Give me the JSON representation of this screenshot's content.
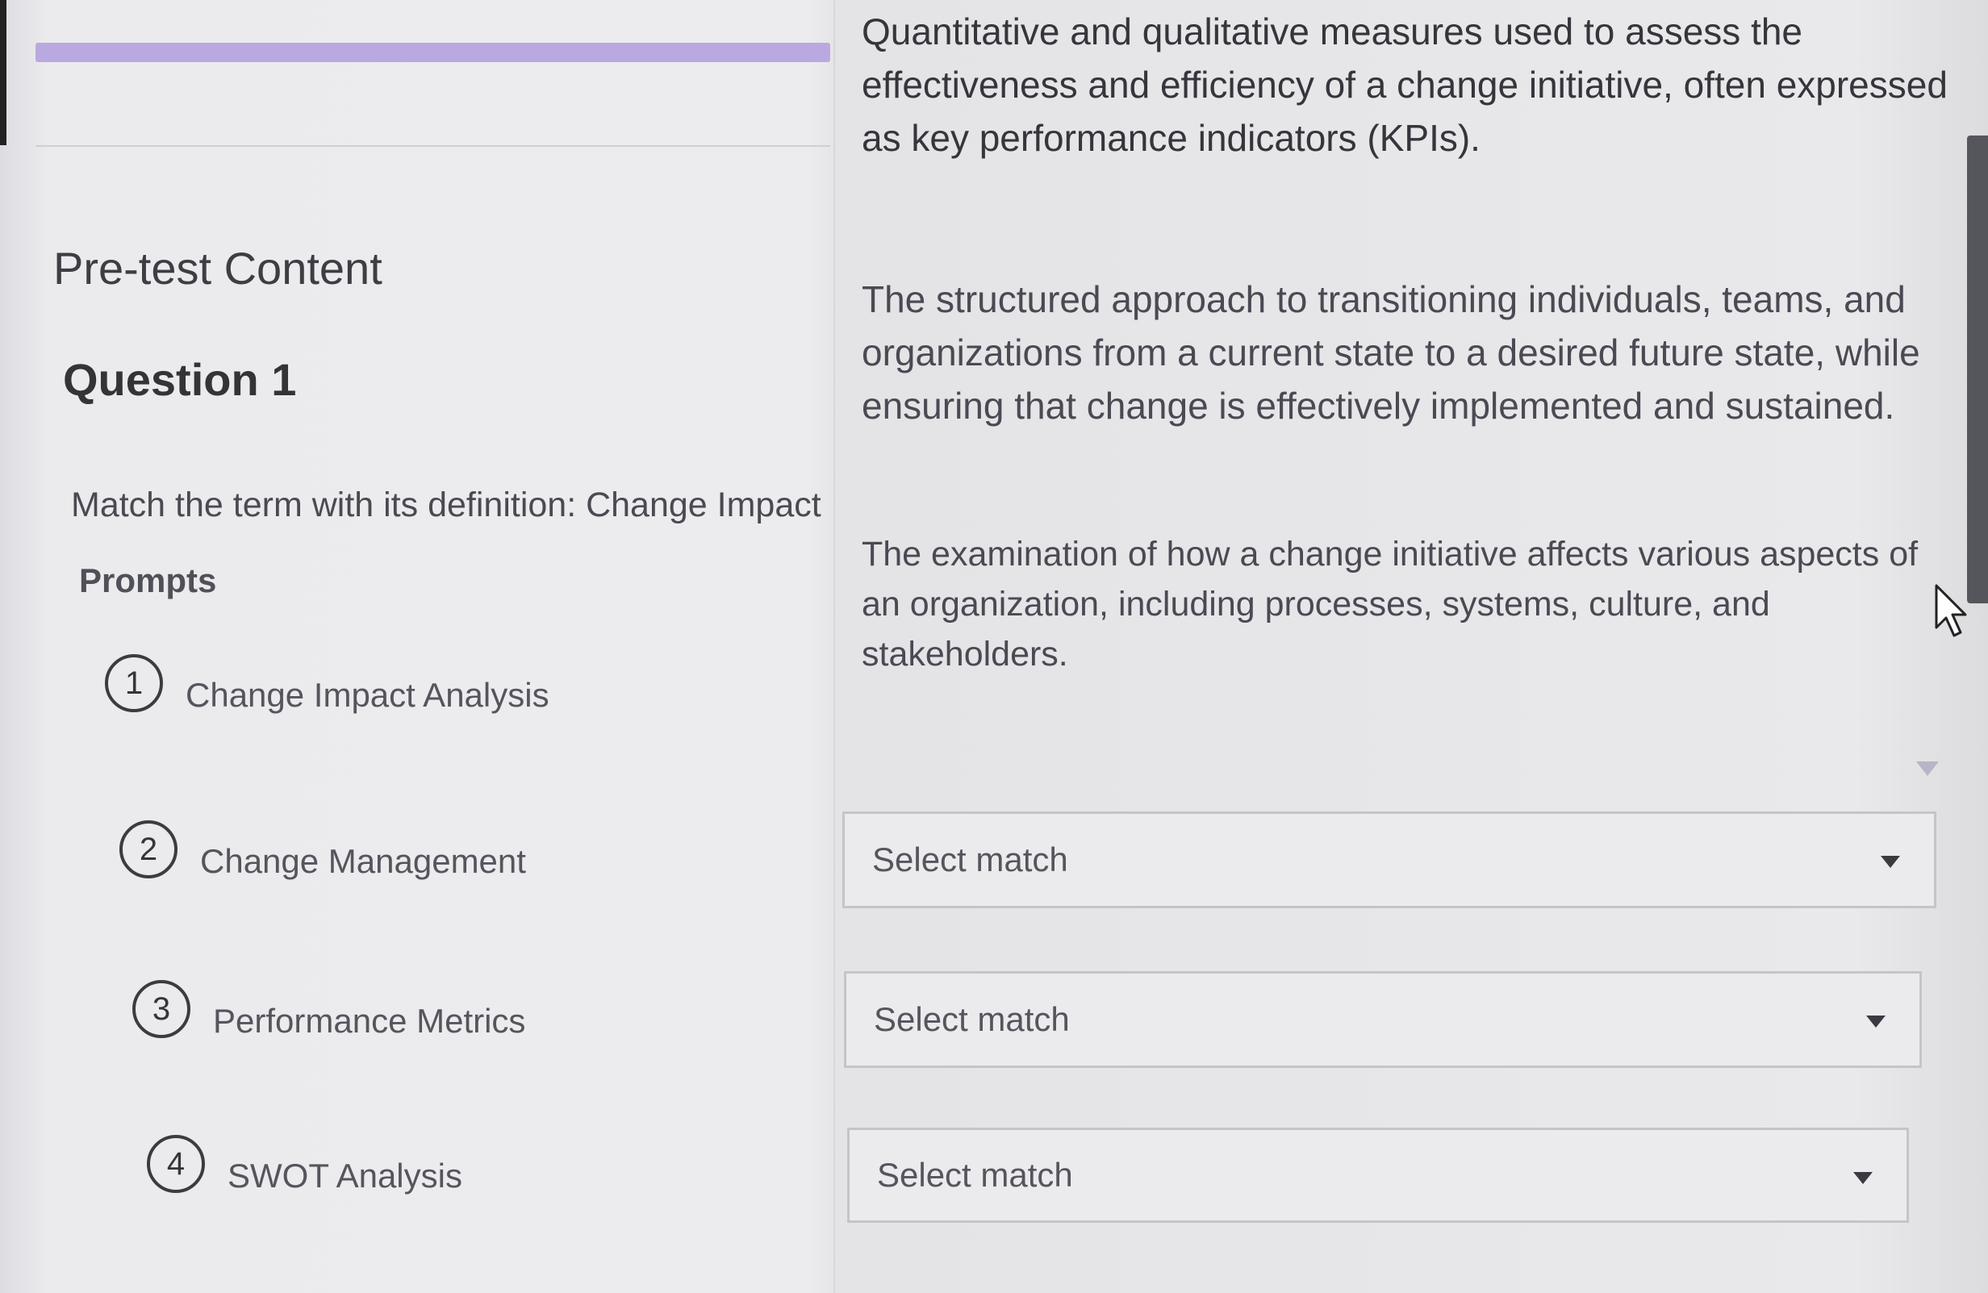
{
  "header": {
    "progress": 1.0
  },
  "section": {
    "title": "Pre-test Content"
  },
  "question": {
    "title": "Question 1",
    "text": "Match the term with its definition: Change Impact",
    "prompts_label": "Prompts"
  },
  "prompts": [
    {
      "number": "1",
      "label": "Change Impact Analysis"
    },
    {
      "number": "2",
      "label": "Change Management"
    },
    {
      "number": "3",
      "label": "Performance Metrics"
    },
    {
      "number": "4",
      "label": "SWOT Analysis"
    }
  ],
  "definitions": [
    {
      "text": "Quantitative and qualitative measures used to assess the effectiveness and efficiency of a change initiative, often expressed as key performance indicators (KPIs)."
    },
    {
      "text": "The structured approach to transitioning individuals, teams, and organizations from a current state to a desired future state, while ensuring that change is effectively implemented and sustained."
    },
    {
      "text": "The examination of how a change initiative affects various aspects of an organization, including processes, systems, culture, and stakeholders."
    }
  ],
  "selects": [
    {
      "value": "Select match"
    },
    {
      "value": "Select match"
    },
    {
      "value": "Select match"
    }
  ],
  "icons": {
    "caret": "chevron-down-icon",
    "cursor": "mouse-pointer-icon"
  }
}
